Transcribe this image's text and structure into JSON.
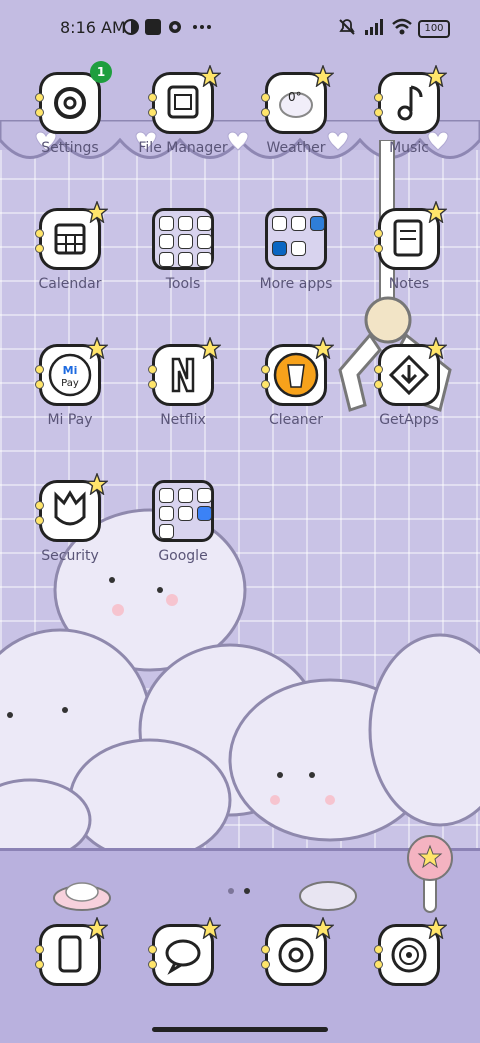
{
  "status": {
    "time": "8:16 AM",
    "battery": "100"
  },
  "apps": [
    {
      "label": "Settings",
      "badge": "1"
    },
    {
      "label": "File Manager"
    },
    {
      "label": "Weather"
    },
    {
      "label": "Music"
    },
    {
      "label": "Calendar"
    },
    {
      "label": "Tools"
    },
    {
      "label": "More apps"
    },
    {
      "label": "Notes"
    },
    {
      "label": "Mi Pay"
    },
    {
      "label": "Netflix"
    },
    {
      "label": "Cleaner"
    },
    {
      "label": "GetApps"
    },
    {
      "label": "Security"
    },
    {
      "label": "Google"
    }
  ],
  "icons": {
    "mipay_text": "Mi Pay"
  },
  "colors": {
    "background": "#c9c3e6",
    "badge": "#1e9e3e",
    "star": "#ffe56b",
    "cleaner_orange": "#f7a21b"
  }
}
